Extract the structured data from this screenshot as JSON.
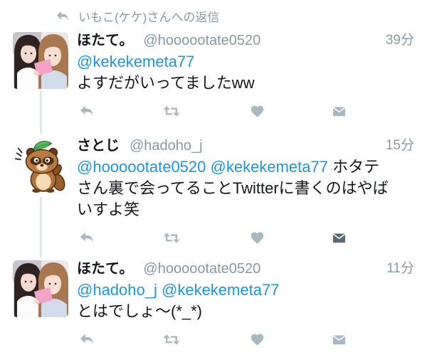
{
  "reply_context": {
    "icon": "reply-icon",
    "text": "いもこ(ケケ)さんへの返信"
  },
  "tweets": [
    {
      "name": "ほたて。",
      "handle": "@hoooootate0520",
      "time": "39分",
      "body": [
        {
          "mentions": [
            "@kekekemeta77"
          ]
        },
        {
          "text": "よすだがいってましたww"
        }
      ]
    },
    {
      "name": "さとじ",
      "handle": "@hadoho_j",
      "time": "15分",
      "body": [
        {
          "mentions": [
            "@hoooootate0520",
            "@kekekemeta77"
          ],
          "text": "ホタテ"
        },
        {
          "text": "さん裏で会ってることTwitterに書くのはやば"
        },
        {
          "text": "いすよ笑"
        }
      ]
    },
    {
      "name": "ほたて。",
      "handle": "@hoooootate0520",
      "time": "11分",
      "body": [
        {
          "mentions": [
            "@hadoho_j",
            "@kekekemeta77"
          ]
        },
        {
          "text": "とはでしょ〜(*_*)"
        }
      ]
    }
  ],
  "actions": [
    "reply-icon",
    "retweet-icon",
    "like-icon",
    "direct-message-icon"
  ],
  "colors": {
    "mention": "#1b95e0",
    "primary_text": "#14171a",
    "secondary_text": "#8899a6",
    "icon": "#aab8c2",
    "thread_line": "#e1e8ed"
  }
}
